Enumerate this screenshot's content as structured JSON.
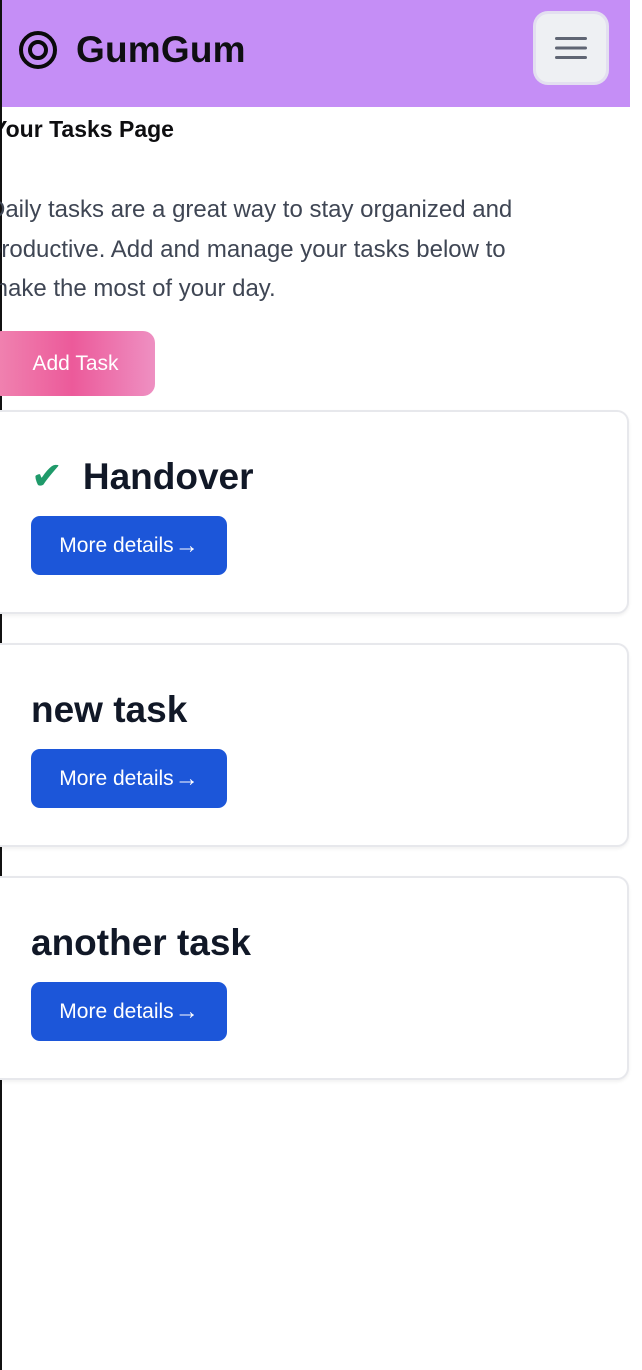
{
  "header": {
    "brand": "GumGum",
    "brand_icon": "target-icon",
    "menu_icon": "hamburger-menu-icon"
  },
  "page": {
    "title": "Your Tasks Page",
    "intro_lines": [
      "Daily tasks are a great way to stay organized and",
      "productive. Add and manage your tasks below to",
      "make the most of your day."
    ],
    "add_task_label": "Add Task"
  },
  "tasks": [
    {
      "title": "Handover",
      "completed": true,
      "details_label": "More details",
      "arrow": "→"
    },
    {
      "title": "new task",
      "completed": false,
      "details_label": "More details",
      "arrow": "→"
    },
    {
      "title": "another task",
      "completed": false,
      "details_label": "More details",
      "arrow": "→"
    }
  ],
  "colors": {
    "navbar": "#c58ef6",
    "add_task_button": "#ec5a9a",
    "details_button": "#1c56d9",
    "check": "#1f9a6a"
  }
}
